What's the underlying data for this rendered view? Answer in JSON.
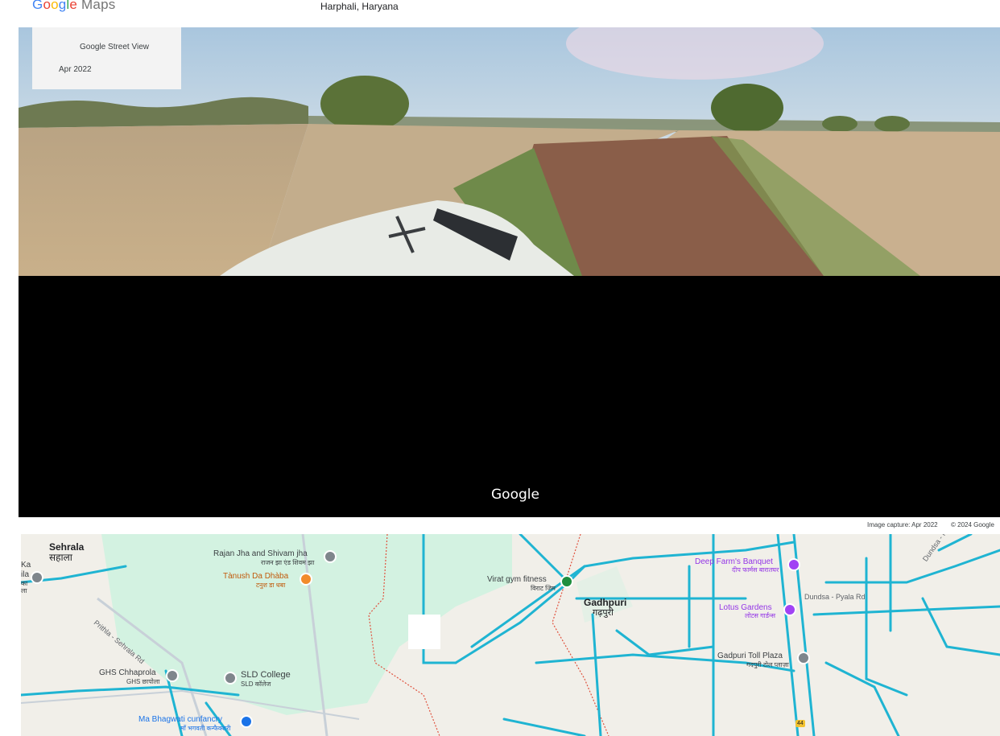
{
  "header": {
    "logo_google": [
      "G",
      "o",
      "o",
      "g",
      "l",
      "e"
    ],
    "logo_maps": "Maps",
    "place": "Harphali, Haryana"
  },
  "streetview": {
    "card_title": "Google Street View",
    "card_date": "Apr 2022",
    "watermark": "Google",
    "image_capture": "Image capture: Apr 2022",
    "copyright": "© 2024 Google"
  },
  "map": {
    "labels": {
      "sehrala_en": "Sehrala",
      "sehrala_hi": "सहाला",
      "left_partial_1": "Ka",
      "left_partial_2": "ila",
      "left_partial_3": "का",
      "left_partial_4": "ला",
      "rajan_en": "Rajan Jha and Shivam jha",
      "rajan_hi": "राजन झा एंड शिवम झा",
      "tanush_en": "Tànush Da Dhàba",
      "tanush_hi": "टनुश डा धबा",
      "road_prithla": "Prithla - Sehrala Rd",
      "virat_en": "Virat gym fitness",
      "virat_hi": "विराट जिम",
      "gadhpuri_en": "Gadhpuri",
      "gadhpuri_hi": "गढ़पुरी",
      "deep_en": "Deep Farm's Banquet",
      "deep_hi": "दीप फार्मस बारातघर",
      "road_dundsa": "Dundsa - Pyala Rd",
      "road_dundsa_2": "Dundsa - Pya",
      "lotus_en": "Lotus Gardens",
      "lotus_hi": "लोटस गार्डन्स",
      "toll_en": "Gadpuri Toll Plaza",
      "toll_hi": "गदपुरी टोल प्लाज़ा",
      "ghs_en": "GHS Chhaprola",
      "ghs_hi": "GHS छापोला",
      "sld_en": "SLD College",
      "sld_hi": "SLD कॉलेज",
      "bhagwati_en": "Ma Bhagwati cunfancry",
      "bhagwati_hi": "माँ भगवती कन्फैक्शरी",
      "nh_shield": "44"
    },
    "colors": {
      "land": "#f1efe9",
      "park": "#d3f2e1",
      "road": "#1fb4d2",
      "boundary": "#e0523e"
    }
  }
}
